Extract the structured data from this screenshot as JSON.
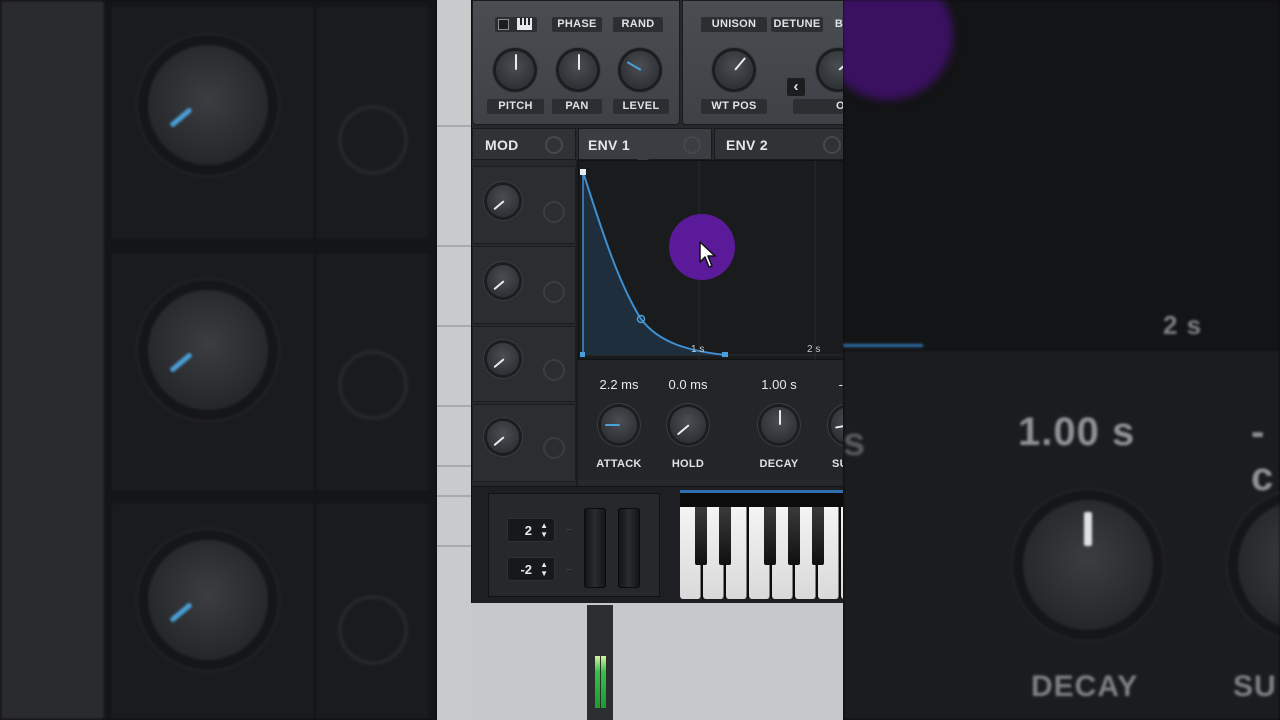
{
  "osc_panel": {
    "top_labels": [
      "PHASE",
      "RAND",
      "UNISON",
      "DETUNE",
      "B"
    ],
    "knob_labels": [
      "PITCH",
      "PAN",
      "LEVEL",
      "WT POS",
      "OF"
    ],
    "nav_arrow": "‹"
  },
  "tabs": [
    {
      "label": "MOD"
    },
    {
      "label": "ENV 1"
    },
    {
      "label": "ENV 2"
    }
  ],
  "envelope": {
    "time_markers": [
      "1 s",
      "2 s"
    ],
    "values": [
      "2.2 ms",
      "0.0 ms",
      "1.00 s",
      "-c"
    ],
    "labels": [
      "ATTACK",
      "HOLD",
      "DECAY",
      "SU"
    ]
  },
  "pitch_range": {
    "up": "2",
    "down": "-2"
  },
  "zoom_left": {},
  "zoom_right": {
    "time_marker": "2 s",
    "value": "1.00 s",
    "value_partial": "-c",
    "label": "DECAY",
    "label_partial": "SU"
  },
  "colors": {
    "accent": "#4aa0d8",
    "cursor": "#5a1a9a",
    "meter": "#39c04a"
  }
}
